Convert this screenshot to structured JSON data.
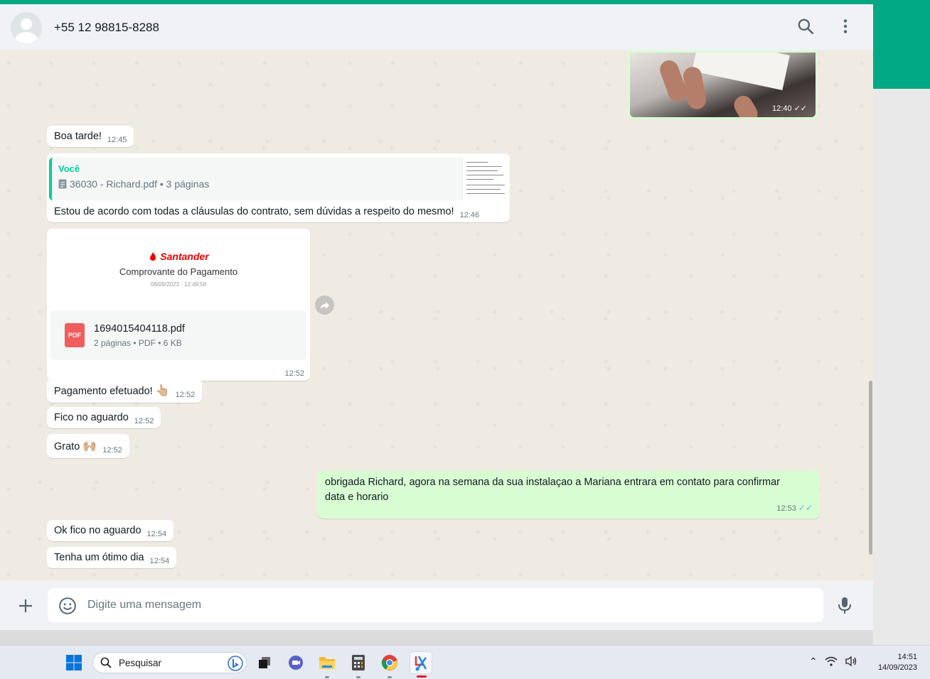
{
  "header": {
    "contact": "+55 12 98815-8288"
  },
  "messages": {
    "image_time": "12:40",
    "m1": {
      "text": "Boa tarde!",
      "time": "12:45"
    },
    "m2": {
      "quote_author": "Você",
      "quote_file": "36030 - Richard.pdf • 3 páginas",
      "text": "Estou de acordo com todas a cláusulas do contrato, sem dúvidas a respeito do mesmo!",
      "time": "12:46"
    },
    "doc": {
      "brand": "Santander",
      "preview_title": "Comprovante do Pagamento",
      "preview_date": "08/09/2023 - 12:49:58",
      "pdf_label": "PDF",
      "file_name": "1694015404118.pdf",
      "file_meta": "2 páginas • PDF • 6 KB",
      "time": "12:52"
    },
    "m3": {
      "text": "Pagamento efetuado!",
      "emoji": "👆🏼",
      "time": "12:52"
    },
    "m4": {
      "text": "Fico no aguardo",
      "time": "12:52"
    },
    "m5": {
      "text": "Grato",
      "emoji": "🙌🏼",
      "time": "12:52"
    },
    "m6": {
      "line1": "obrigada Richard, agora na semana da sua instalaçao a Mariana entrara em contato para confirmar",
      "line2": "data e horario",
      "time": "12:53"
    },
    "m7": {
      "text": "Ok fico no aguardo",
      "time": "12:54"
    },
    "m8": {
      "text": "Tenha um ótimo dia",
      "time": "12:54"
    }
  },
  "composer": {
    "placeholder": "Digite uma mensagem"
  },
  "taskbar": {
    "search_label": "Pesquisar",
    "time": "14:51",
    "date": "14/09/2023"
  }
}
